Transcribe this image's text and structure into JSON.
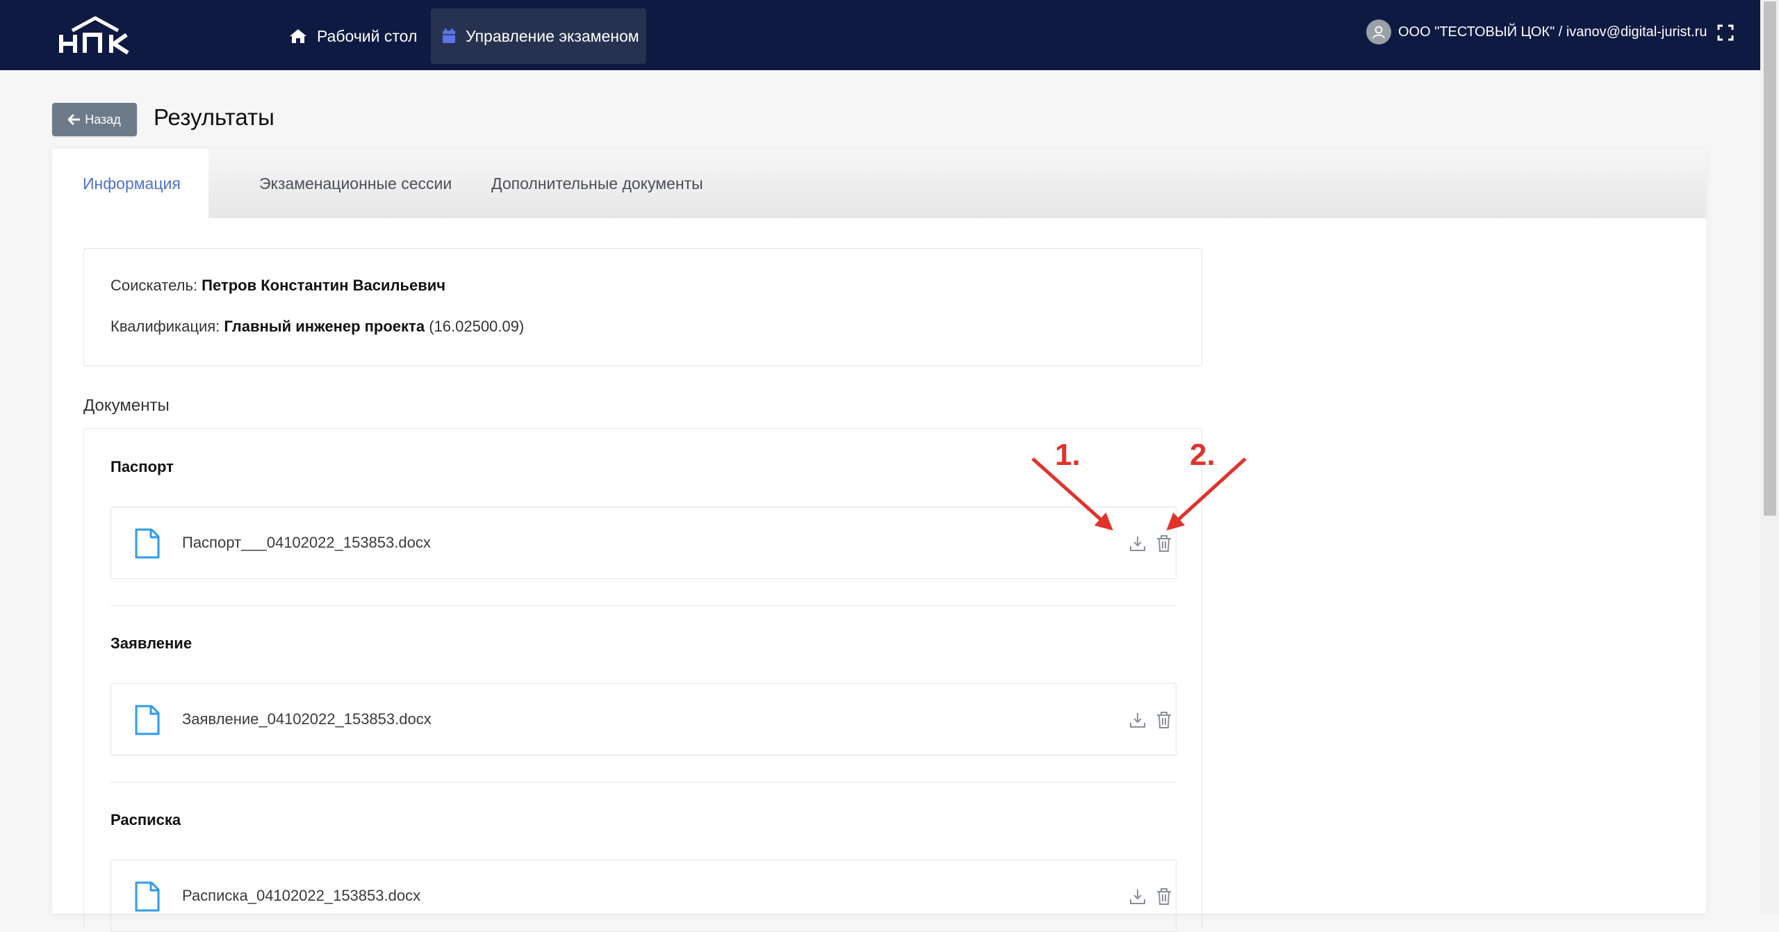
{
  "navbar": {
    "logo_text": "НПК",
    "home_label": "Рабочий стол",
    "exam_label": "Управление экзаменом",
    "user_label": "ООО \"ТЕСТОВЫЙ ЦОК\" / ivanov@digital-jurist.ru",
    "bg_color": "#0e1a42",
    "active_bg_color": "#26324f",
    "exam_icon_color": "#5b74e8"
  },
  "header": {
    "back_label": "Назад",
    "title": "Результаты"
  },
  "tabs": [
    {
      "label": "Информация",
      "active": true
    },
    {
      "label": "Экзаменационные сессии",
      "active": false
    },
    {
      "label": "Дополнительные документы",
      "active": false
    }
  ],
  "info": {
    "applicant_label": "Соискатель:",
    "applicant_value": "Петров Константин Васильевич",
    "qualification_label": "Квалификация:",
    "qualification_value": "Главный инженер проекта",
    "qualification_code": "(16.02500.09)"
  },
  "documents": {
    "heading": "Документы",
    "sections": [
      {
        "title": "Паспорт",
        "file": "Паспорт___04102022_153853.docx"
      },
      {
        "title": "Заявление",
        "file": "Заявление_04102022_153853.docx"
      },
      {
        "title": "Расписка",
        "file": "Расписка_04102022_153853.docx"
      }
    ]
  },
  "annotations": {
    "label_1": "1.",
    "label_2": "2.",
    "color": "#e0332b"
  },
  "colors": {
    "accent": "#4f72c9",
    "file_icon": "#2d9bf0",
    "back_button": "#6c7a89"
  },
  "icons": {
    "home": "home-icon",
    "calendar": "calendar-icon",
    "avatar": "user-avatar-icon",
    "fullscreen": "fullscreen-icon",
    "back": "arrow-left-icon",
    "file": "file-icon",
    "download": "download-icon",
    "delete": "trash-icon"
  }
}
